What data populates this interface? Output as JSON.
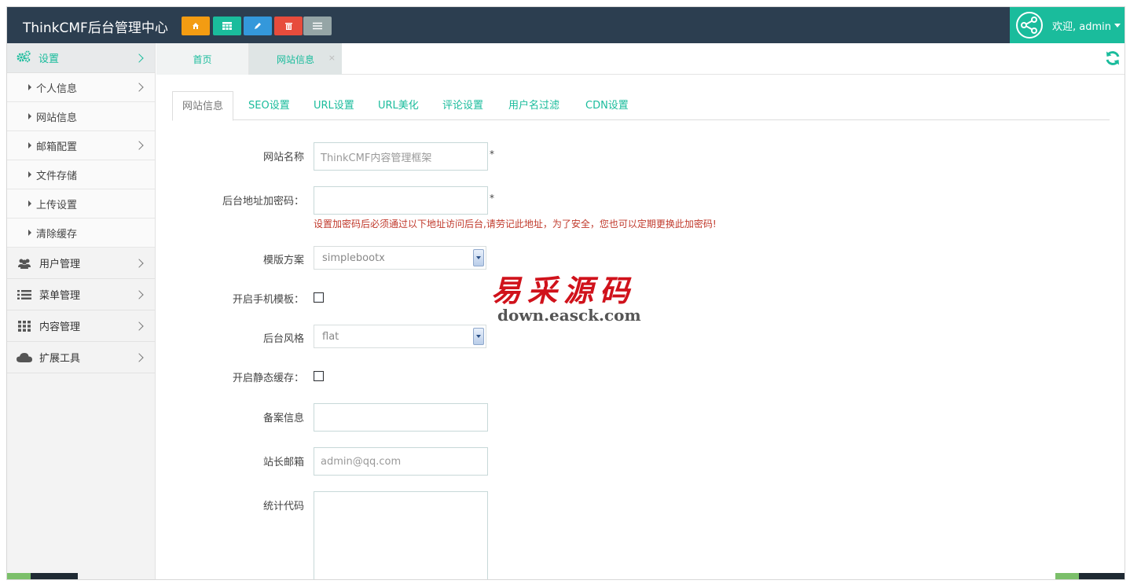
{
  "navbar": {
    "brand": "ThinkCMF后台管理中心",
    "quick_icons": [
      "home-icon",
      "table-icon",
      "pencil-icon",
      "trash-icon",
      "list-icon"
    ],
    "user_label": "欢迎, admin"
  },
  "sidebar": {
    "active_group": {
      "label": "设置",
      "icon": "gears-icon"
    },
    "sub_items": [
      {
        "label": "个人信息",
        "has_children": true
      },
      {
        "label": "网站信息",
        "has_children": false
      },
      {
        "label": "邮箱配置",
        "has_children": true
      },
      {
        "label": "文件存储",
        "has_children": false
      },
      {
        "label": "上传设置",
        "has_children": false
      },
      {
        "label": "清除缓存",
        "has_children": false
      }
    ],
    "groups": [
      {
        "label": "用户管理",
        "icon": "users-icon"
      },
      {
        "label": "菜单管理",
        "icon": "list-icon"
      },
      {
        "label": "内容管理",
        "icon": "grid-icon"
      },
      {
        "label": "扩展工具",
        "icon": "cloud-icon"
      }
    ]
  },
  "page_tabs": {
    "home": "首页",
    "current": "网站信息",
    "close": "×"
  },
  "content_tabs": [
    "网站信息",
    "SEO设置",
    "URL设置",
    "URL美化",
    "评论设置",
    "用户名过滤",
    "CDN设置"
  ],
  "form": {
    "site_name": {
      "label": "网站名称",
      "value": "ThinkCMF内容管理框架",
      "required": "*"
    },
    "admin_password": {
      "label": "后台地址加密码：",
      "value": "",
      "required": "*",
      "hint": "设置加密码后必须通过以下地址访问后台,请劳记此地址，为了安全，您也可以定期更换此加密码!"
    },
    "template": {
      "label": "模版方案",
      "value": "simplebootx"
    },
    "mobile_template": {
      "label": "开启手机模板：",
      "checked": false
    },
    "admin_style": {
      "label": "后台风格",
      "value": "flat"
    },
    "static_cache": {
      "label": "开启静态缓存：",
      "checked": false
    },
    "icp": {
      "label": "备案信息",
      "value": ""
    },
    "admin_email": {
      "label": "站长邮箱",
      "value": "admin@qq.com"
    },
    "stat_code": {
      "label": "统计代码",
      "value": ""
    }
  },
  "watermark": {
    "cn": "易采源码",
    "en": "down.easck.com"
  },
  "colors": {
    "navbar": "#2c3e50",
    "accent": "#1abc9c",
    "hint": "#c0392b"
  }
}
